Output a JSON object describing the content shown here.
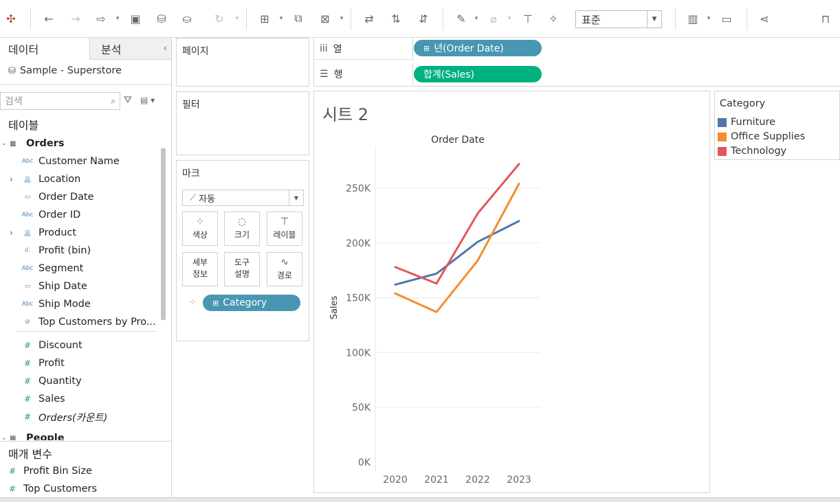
{
  "toolbar": {
    "standard_select": "표준",
    "icons": [
      "tableau-logo-icon",
      "undo-icon",
      "redo-icon",
      "replay-icon",
      "save-icon",
      "new-datasource-icon",
      "pause-update-icon",
      "refresh-icon",
      "new-worksheet-icon",
      "duplicate-icon",
      "clear-sheet-icon",
      "swap-icon",
      "sort-asc-icon",
      "sort-desc-icon",
      "highlight-icon",
      "group-icon",
      "label-icon",
      "pin-icon",
      "show-me-icon",
      "presentation-icon",
      "share-icon",
      "pin-right-icon"
    ]
  },
  "left_panel": {
    "tab_data": "데이터",
    "tab_analysis": "분석",
    "datasource": "Sample - Superstore",
    "search_placeholder": "검색",
    "tables_header": "테이블",
    "orders_table": "Orders",
    "dimension_fields": [
      {
        "type": "Abc",
        "name": "Customer Name"
      },
      {
        "type": "hier",
        "name": "Location"
      },
      {
        "type": "date",
        "name": "Order Date"
      },
      {
        "type": "Abc",
        "name": "Order ID"
      },
      {
        "type": "hier",
        "name": "Product"
      },
      {
        "type": "bin",
        "name": "Profit (bin)"
      },
      {
        "type": "Abc",
        "name": "Segment"
      },
      {
        "type": "date",
        "name": "Ship Date"
      },
      {
        "type": "Abc",
        "name": "Ship Mode"
      },
      {
        "type": "set",
        "name": "Top Customers by Pro..."
      }
    ],
    "measure_fields": [
      {
        "type": "#",
        "name": "Discount"
      },
      {
        "type": "#",
        "name": "Profit"
      },
      {
        "type": "#",
        "name": "Quantity"
      },
      {
        "type": "#",
        "name": "Sales"
      },
      {
        "type": "#",
        "name": "Orders(카운트)"
      }
    ],
    "people_table": "People",
    "params_header": "매개 변수",
    "params": [
      {
        "type": "#",
        "name": "Profit Bin Size"
      },
      {
        "type": "#",
        "name": "Top Customers"
      }
    ]
  },
  "shelves": {
    "pages_title": "페이지",
    "filters_title": "필터",
    "marks_title": "마크",
    "mark_type": "자동",
    "mark_buttons": [
      {
        "label": "색상",
        "icon": "color-icon"
      },
      {
        "label": "크기",
        "icon": "size-icon"
      },
      {
        "label": "레이블",
        "icon": "label-icon"
      },
      {
        "label": "세부\n정보",
        "icon": "detail-icon"
      },
      {
        "label": "도구\n설명",
        "icon": "tooltip-icon"
      },
      {
        "label": "경로",
        "icon": "path-icon"
      }
    ],
    "category_pill": "Category",
    "columns_label": "열",
    "rows_label": "행",
    "columns_pill": "년(Order Date)",
    "rows_pill": "합계(Sales)"
  },
  "sheet": {
    "title": "시트 2"
  },
  "legend": {
    "title": "Category",
    "items": [
      {
        "name": "Furniture",
        "color": "#4e79a7"
      },
      {
        "name": "Office Supplies",
        "color": "#f28e2b"
      },
      {
        "name": "Technology",
        "color": "#e15759"
      }
    ]
  },
  "colors": {
    "pill_blue": "#4996b2",
    "pill_green": "#00b180"
  },
  "chart_data": {
    "type": "line",
    "title": "Order Date",
    "xlabel": "",
    "ylabel": "Sales",
    "categories": [
      "2020",
      "2021",
      "2022",
      "2023"
    ],
    "ylim": [
      0,
      280000
    ],
    "yticks": [
      0,
      50000,
      100000,
      150000,
      200000,
      250000
    ],
    "ytick_labels": [
      "0K",
      "50K",
      "100K",
      "150K",
      "200K",
      "250K"
    ],
    "grid": true,
    "series": [
      {
        "name": "Furniture",
        "color": "#4e79a7",
        "values": [
          162000,
          172000,
          201000,
          220000
        ]
      },
      {
        "name": "Office Supplies",
        "color": "#f28e2b",
        "values": [
          154000,
          137000,
          184000,
          254000
        ]
      },
      {
        "name": "Technology",
        "color": "#e15759",
        "values": [
          178000,
          163000,
          227000,
          272000
        ]
      }
    ]
  }
}
